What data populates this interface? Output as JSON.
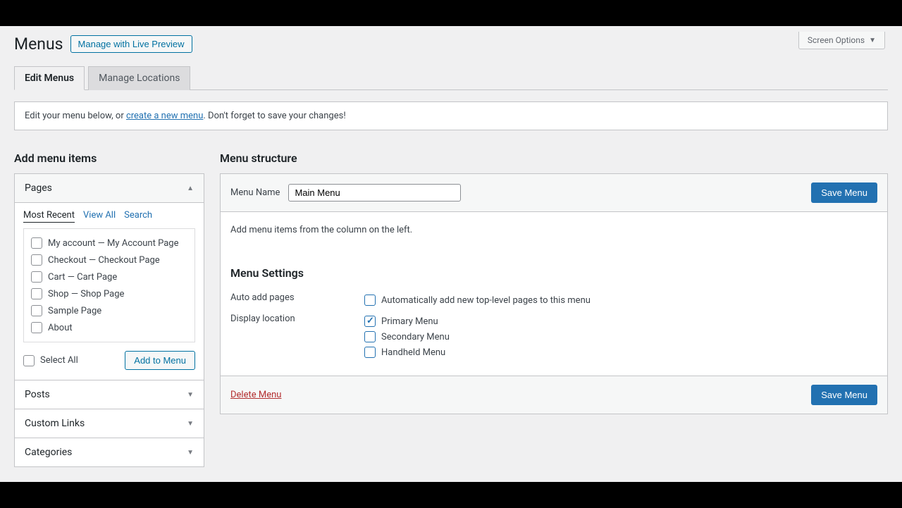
{
  "header": {
    "page_title": "Menus",
    "preview_button": "Manage with Live Preview",
    "screen_options": "Screen Options"
  },
  "tabs": {
    "edit_menus": "Edit Menus",
    "manage_locations": "Manage Locations"
  },
  "notice": {
    "prefix": "Edit your menu below, or ",
    "link": "create a new menu",
    "suffix": ". Don't forget to save your changes!"
  },
  "left": {
    "title": "Add menu items",
    "pages": {
      "header": "Pages",
      "subtabs": {
        "recent": "Most Recent",
        "viewall": "View All",
        "search": "Search"
      },
      "items": [
        "My account — My Account Page",
        "Checkout — Checkout Page",
        "Cart — Cart Page",
        "Shop — Shop Page",
        "Sample Page",
        "About"
      ],
      "select_all": "Select All",
      "add_button": "Add to Menu"
    },
    "posts": "Posts",
    "custom_links": "Custom Links",
    "categories": "Categories"
  },
  "right": {
    "title": "Menu structure",
    "menu_name_label": "Menu Name",
    "menu_name_value": "Main Menu",
    "save_button": "Save Menu",
    "body_text": "Add menu items from the column on the left.",
    "settings_title": "Menu Settings",
    "auto_add_label": "Auto add pages",
    "auto_add_option": "Automatically add new top-level pages to this menu",
    "display_label": "Display location",
    "locations": {
      "primary": "Primary Menu",
      "secondary": "Secondary Menu",
      "handheld": "Handheld Menu"
    },
    "delete": "Delete Menu"
  }
}
